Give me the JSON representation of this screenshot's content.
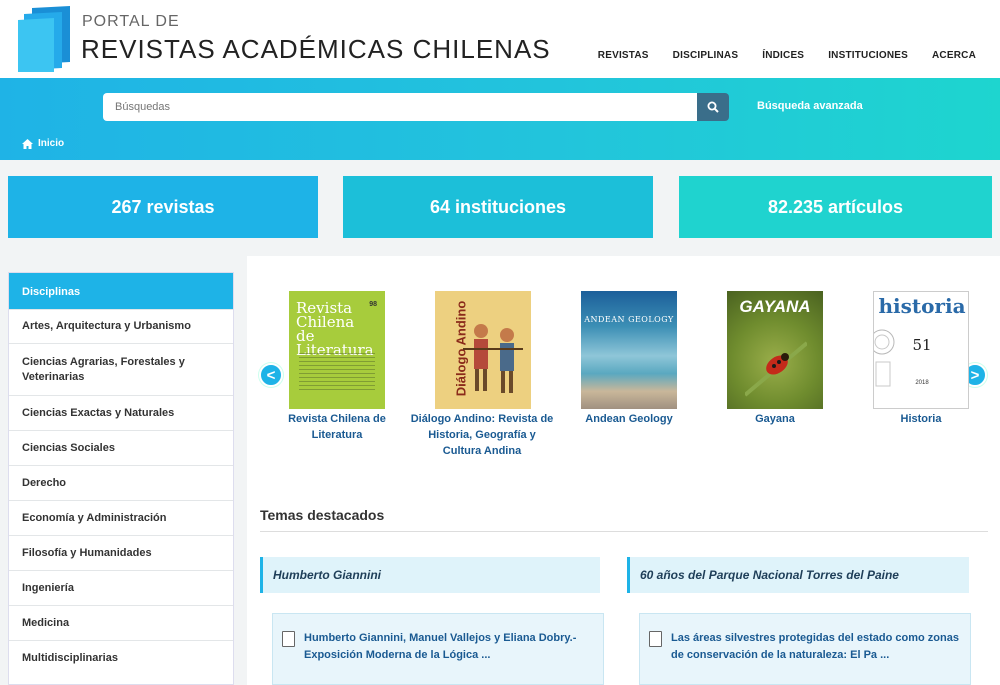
{
  "header": {
    "brand_top": "PORTAL DE",
    "brand_main": "REVISTAS ACADÉMICAS CHILENAS",
    "nav": [
      "REVISTAS",
      "DISCIPLINAS",
      "ÍNDICES",
      "INSTITUCIONES",
      "ACERCA"
    ]
  },
  "search": {
    "placeholder": "Búsquedas",
    "button_icon": "search-icon",
    "advanced_label": "Búsqueda avanzada"
  },
  "breadcrumb": {
    "icon": "home-icon",
    "label": "Inicio"
  },
  "stats": {
    "revistas": "267 revistas",
    "instituciones": "64 instituciones",
    "articulos": "82.235 artículos"
  },
  "sidebar": {
    "title": "Disciplinas",
    "items": [
      "Artes, Arquitectura y Urbanismo",
      "Ciencias Agrarias, Forestales y Veterinarias",
      "Ciencias Exactas y Naturales",
      "Ciencias Sociales",
      "Derecho",
      "Economía y Administración",
      "Filosofía y Humanidades",
      "Ingeniería",
      "Medicina",
      "Multidisciplinarias"
    ]
  },
  "carousel": {
    "prev": "<",
    "next": ">",
    "journals": [
      {
        "title": "Revista Chilena de Literatura",
        "cover_line1": "Revista",
        "cover_line2": "Chilena",
        "cover_line3": "de Literatura",
        "cover_number": "98",
        "color": "#a7cc3c"
      },
      {
        "title": "Diálogo Andino: Revista de Historia, Geografía y Cultura Andina",
        "cover_line1": "Diálogo Andino",
        "color": "#e8b840"
      },
      {
        "title": "Andean Geology",
        "cover_line1": "ANDEAN GEOLOGY",
        "color": "#3c8fb5"
      },
      {
        "title": "Gayana",
        "cover_line1": "GAYANA",
        "color": "#6f8c2e"
      },
      {
        "title": "Historia",
        "cover_line1": "historia",
        "cover_number": "51",
        "cover_year": "2018",
        "color": "#ffffff"
      }
    ]
  },
  "temas": {
    "heading": "Temas destacados",
    "topics": [
      {
        "title": "Humberto Giannini",
        "article": "Humberto Giannini, Manuel Vallejos y Eliana Dobry.- Exposición Moderna de la Lógica ..."
      },
      {
        "title": "60 años del Parque Nacional Torres del Paine",
        "article": "Las áreas silvestres protegidas del estado como zonas de conservación de la naturaleza: El Pa ..."
      }
    ]
  },
  "colors": {
    "accent": "#1eb3e7",
    "teal": "#1fd3cf",
    "link": "#1a5a92"
  }
}
